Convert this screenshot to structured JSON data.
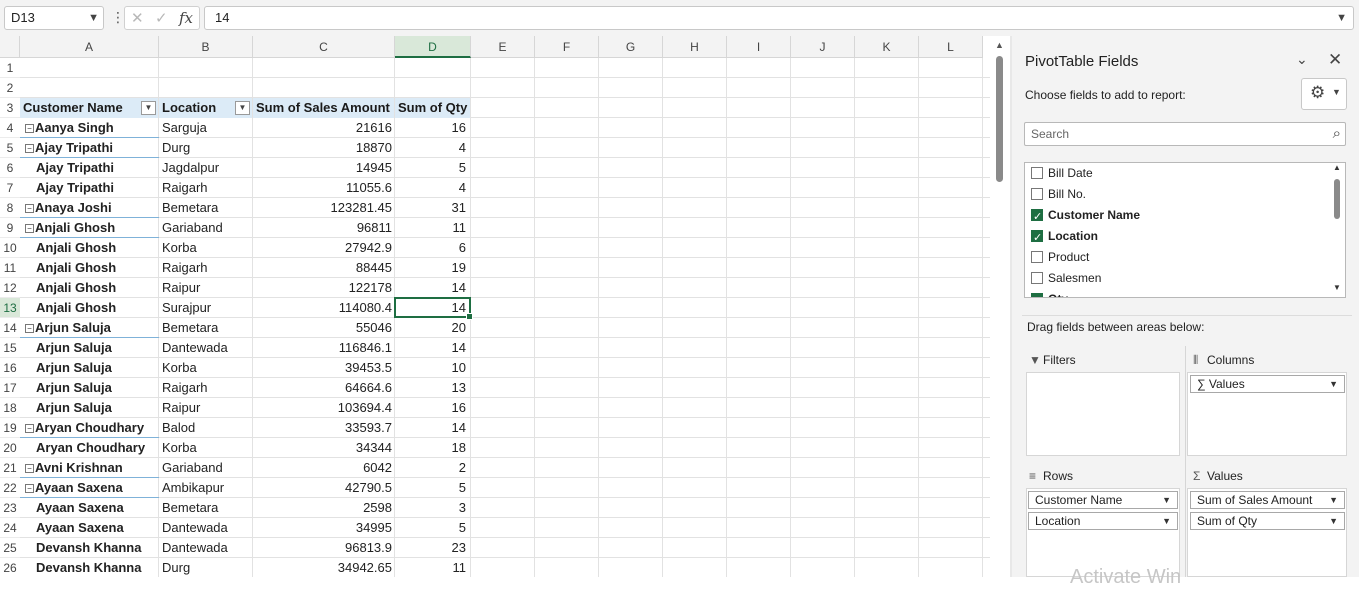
{
  "formula_bar": {
    "name_box": "D13",
    "cancel_icon": "✕",
    "enter_icon": "✓",
    "fx_label": "fx",
    "value": "14"
  },
  "columns": [
    "A",
    "B",
    "C",
    "D",
    "E",
    "F",
    "G",
    "H",
    "I",
    "J",
    "K",
    "L"
  ],
  "selected_column": "D",
  "selected_row": "13",
  "pivot_headers": {
    "customer_name": "Customer Name",
    "location": "Location",
    "sum_sales": "Sum of Sales Amount",
    "sum_qty": "Sum of Qty"
  },
  "rows": [
    {
      "row": "1"
    },
    {
      "row": "2"
    },
    {
      "row": "3"
    },
    {
      "row": "4",
      "name": "Aanya Singh",
      "location": "Sarguja",
      "sales": "21616",
      "qty": "16",
      "group": true
    },
    {
      "row": "5",
      "name": "Ajay Tripathi",
      "location": "Durg",
      "sales": "18870",
      "qty": "4",
      "group": true
    },
    {
      "row": "6",
      "name": "Ajay Tripathi",
      "location": "Jagdalpur",
      "sales": "14945",
      "qty": "5"
    },
    {
      "row": "7",
      "name": "Ajay Tripathi",
      "location": "Raigarh",
      "sales": "11055.6",
      "qty": "4"
    },
    {
      "row": "8",
      "name": "Anaya Joshi",
      "location": "Bemetara",
      "sales": "123281.45",
      "qty": "31",
      "group": true
    },
    {
      "row": "9",
      "name": "Anjali Ghosh",
      "location": "Gariaband",
      "sales": "96811",
      "qty": "11",
      "group": true
    },
    {
      "row": "10",
      "name": "Anjali Ghosh",
      "location": "Korba",
      "sales": "27942.9",
      "qty": "6"
    },
    {
      "row": "11",
      "name": "Anjali Ghosh",
      "location": "Raigarh",
      "sales": "88445",
      "qty": "19"
    },
    {
      "row": "12",
      "name": "Anjali Ghosh",
      "location": "Raipur",
      "sales": "122178",
      "qty": "14"
    },
    {
      "row": "13",
      "name": "Anjali Ghosh",
      "location": "Surajpur",
      "sales": "114080.4",
      "qty": "14"
    },
    {
      "row": "14",
      "name": "Arjun Saluja",
      "location": "Bemetara",
      "sales": "55046",
      "qty": "20",
      "group": true
    },
    {
      "row": "15",
      "name": "Arjun Saluja",
      "location": "Dantewada",
      "sales": "116846.1",
      "qty": "14"
    },
    {
      "row": "16",
      "name": "Arjun Saluja",
      "location": "Korba",
      "sales": "39453.5",
      "qty": "10"
    },
    {
      "row": "17",
      "name": "Arjun Saluja",
      "location": "Raigarh",
      "sales": "64664.6",
      "qty": "13"
    },
    {
      "row": "18",
      "name": "Arjun Saluja",
      "location": "Raipur",
      "sales": "103694.4",
      "qty": "16"
    },
    {
      "row": "19",
      "name": "Aryan Choudhary",
      "location": "Balod",
      "sales": "33593.7",
      "qty": "14",
      "group": true
    },
    {
      "row": "20",
      "name": "Aryan Choudhary",
      "location": "Korba",
      "sales": "34344",
      "qty": "18"
    },
    {
      "row": "21",
      "name": "Avni Krishnan",
      "location": "Gariaband",
      "sales": "6042",
      "qty": "2",
      "group": true
    },
    {
      "row": "22",
      "name": "Ayaan Saxena",
      "location": "Ambikapur",
      "sales": "42790.5",
      "qty": "5",
      "group": true
    },
    {
      "row": "23",
      "name": "Ayaan Saxena",
      "location": "Bemetara",
      "sales": "2598",
      "qty": "3"
    },
    {
      "row": "24",
      "name": "Ayaan Saxena",
      "location": "Dantewada",
      "sales": "34995",
      "qty": "5"
    },
    {
      "row": "25",
      "name": "Devansh Khanna",
      "location": "Dantewada",
      "sales": "96813.9",
      "qty": "23"
    },
    {
      "row": "26",
      "name": "Devansh Khanna",
      "location": "Durg",
      "sales": "34942.65",
      "qty": "11"
    }
  ],
  "pane": {
    "title": "PivotTable Fields",
    "choose_text": "Choose fields to add to report:",
    "search_placeholder": "Search",
    "fields": [
      {
        "label": "Bill Date",
        "checked": false
      },
      {
        "label": "Bill No.",
        "checked": false
      },
      {
        "label": "Customer Name",
        "checked": true
      },
      {
        "label": "Location",
        "checked": true
      },
      {
        "label": "Product",
        "checked": false
      },
      {
        "label": "Salesmen",
        "checked": false
      },
      {
        "label": "Qty",
        "checked": true
      }
    ],
    "drag_text": "Drag fields between areas below:",
    "filters_label": "Filters",
    "columns_label": "Columns",
    "rows_label": "Rows",
    "values_label": "Values",
    "columns_items": [
      "∑ Values"
    ],
    "rows_items": [
      "Customer Name",
      "Location"
    ],
    "values_items": [
      "Sum of Sales Amount",
      "Sum of Qty"
    ],
    "watermark": "Activate Win"
  },
  "icons": {
    "collapse": "−",
    "dropdown": "▾",
    "chevron_down": "⌄",
    "close": "✕",
    "gear": "⚙",
    "search": "⌕"
  }
}
